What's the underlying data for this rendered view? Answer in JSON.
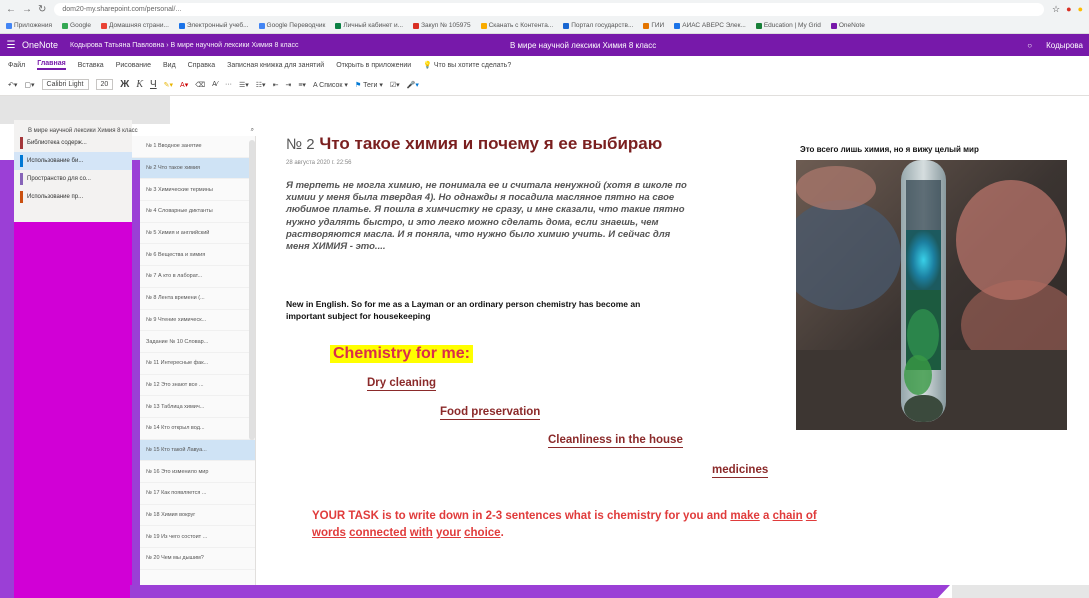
{
  "browser": {
    "url": "dom20-my.sharepoint.com/personal/...",
    "bookmarks": [
      "Приложения",
      "Google",
      "Домашняя страни...",
      "Электронный учеб...",
      "Google Переводчик",
      "Личный кабинет и...",
      "Закуп № 105975",
      "Сканать с Контента...",
      "Портал государств...",
      "ГИИ",
      "АИАС АВЕРС Элек...",
      "Education | My Grid",
      "OneNote"
    ]
  },
  "header": {
    "app_name": "OneNote",
    "breadcrumb": "Кодырова Татьяна Павловна › В мире научной лексики Химия 8 класс",
    "center_title": "В мире научной лексики Химия 8 класс",
    "user": "Кодырова"
  },
  "ribbon": {
    "tabs": [
      "Файл",
      "Главная",
      "Вставка",
      "Рисование",
      "Вид",
      "Справка",
      "Записная книжка для занятий",
      "Открыть в приложении",
      "Что вы хотите сделать?"
    ],
    "font_name": "Calibri Light",
    "font_size": "20",
    "buttons": [
      "Список",
      "Теги",
      "Ж",
      "К",
      "Ч"
    ]
  },
  "notebook": {
    "title": "В мире научной лексики Химия 8 класс",
    "sections": [
      {
        "label": "Библиотека содерж...",
        "color": "#a4373a"
      },
      {
        "label": "Использование би...",
        "color": "#0078d4"
      },
      {
        "label": "Пространство для со...",
        "color": "#8764b8"
      },
      {
        "label": "Использование пр...",
        "color": "#ca5010"
      }
    ],
    "pages": [
      "№ 1 Вводное занятие",
      "№ 2 Что такое химия",
      "№ 3 Химические термины",
      "№ 4 Словарные диктанты",
      "№ 5 Химия и английский",
      "№ 6 Вещества и химия",
      "№ 7 А кто в лаборат...",
      "№ 8 Лента времени (...",
      "№ 9 Чтение химическ...",
      "Задание № 10 Словар...",
      "№ 11 Интересные фак...",
      "№ 12 Это знают все ...",
      "№ 13 Таблица химич...",
      "№ 14 Кто открыл вод...",
      "№ 15 Кто такой Лавуа...",
      "№ 16 Это изменило мир",
      "№ 17 Как появляется ...",
      "№ 18 Химия вокруг",
      "№ 19 Из чего состоит ...",
      "№ 20 Чем мы дышим?"
    ],
    "active_page_index": 1
  },
  "page": {
    "number": "№ 2",
    "title": "Что такое химия и почему я ее выбираю",
    "date": "28 августа 2020 г.    22:56",
    "ru_paragraph": "Я терпеть не могла химию, не понимала ее и считала ненужной (хотя в школе по химии у меня была твердая 4). Но однажды я посадила масляное пятно на свое любимое платье. Я пошла в химчистку не сразу, и мне сказали, что такие пятно нужно удалять быстро, и это легко можно сделать дома, если знаешь, чем растворяются масла. И я поняла, что нужно было химию учить. И сейчас для меня ХИМИЯ - это....",
    "en_paragraph": "New in English. So for me as a Layman or an ordinary person chemistry has become an important subject for housekeeping",
    "chem_heading": "Chemistry for me:",
    "items": [
      "Dry cleaning",
      "Food preservation",
      "Cleanliness in the house",
      "medicines"
    ],
    "task_lead": "YOUR TASK  is to write down in 2-3 sentences what is chemistry for you and",
    "task_make": "make",
    "task_a": "a",
    "task_chain": "chain",
    "task_of": "of",
    "task_words": "words",
    "task_connected": "connected",
    "task_with": "with",
    "task_your": "your",
    "task_choice": "choice",
    "photo_caption": "Это всего лишь химия, но я вижу целый мир"
  },
  "colors": {
    "onenote_purple": "#7719aa",
    "slide_purple": "#9b3fd6",
    "slide_magenta": "#d100d6",
    "title_red": "#7a1f1f",
    "task_red": "#e03b3b",
    "highlight": "#ffff00"
  }
}
